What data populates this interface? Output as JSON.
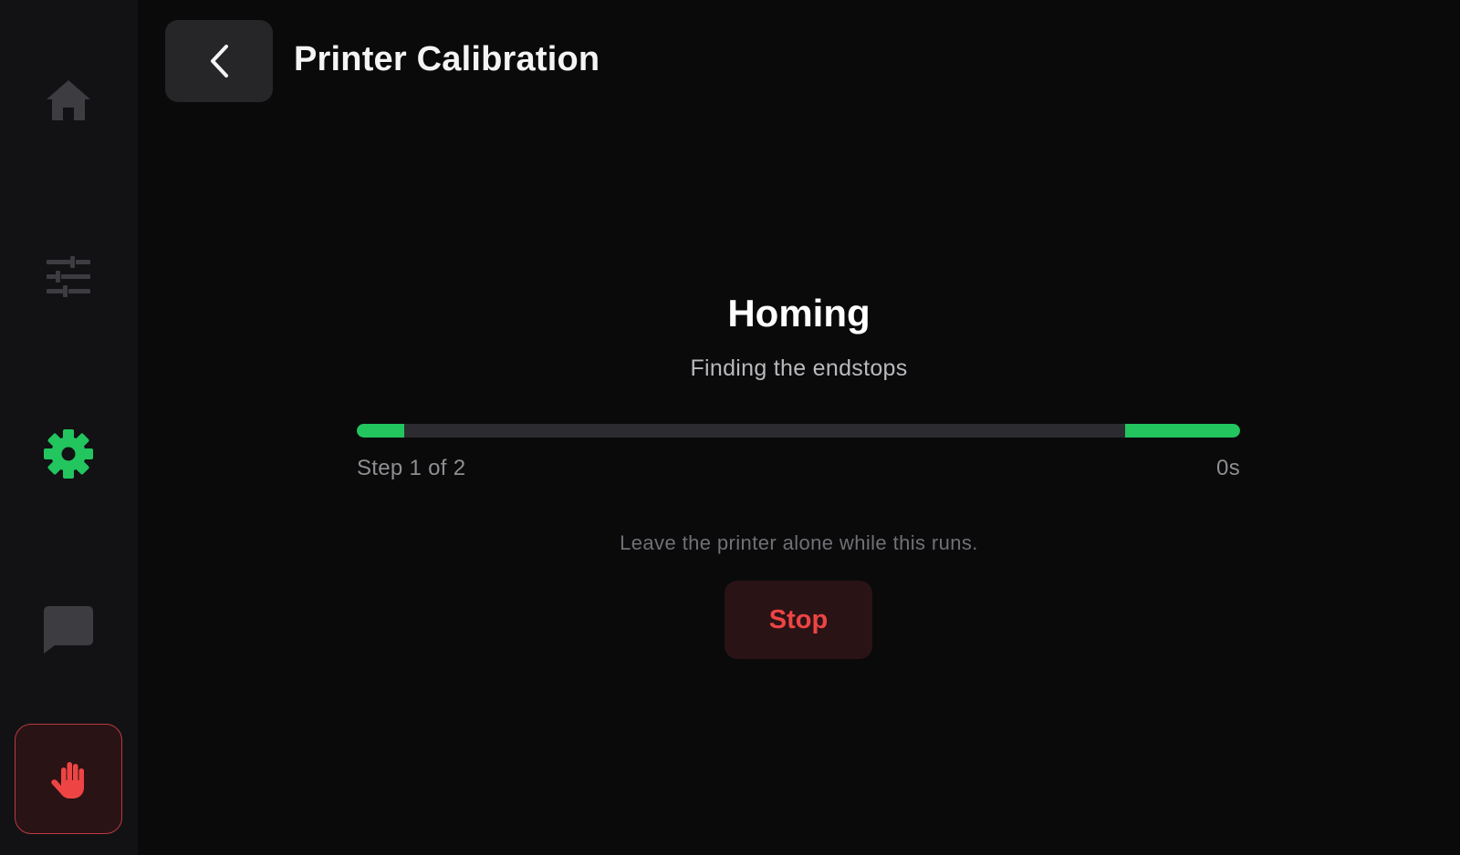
{
  "header": {
    "title": "Printer Calibration",
    "back_icon": "chevron-left-icon"
  },
  "sidebar": {
    "items": [
      {
        "id": "home",
        "icon": "home-icon",
        "active": false,
        "color": "#3c3c41"
      },
      {
        "id": "controls",
        "icon": "sliders-icon",
        "active": false,
        "color": "#3c3c41"
      },
      {
        "id": "settings",
        "icon": "gear-icon",
        "active": true,
        "color": "#22c55e"
      },
      {
        "id": "messages",
        "icon": "chat-bubble-icon",
        "active": false,
        "color": "#3c3c41"
      },
      {
        "id": "emergency-stop",
        "icon": "hand-stop-icon",
        "active": false,
        "color": "#ef4444"
      }
    ]
  },
  "status": {
    "title": "Homing",
    "subtitle": "Finding the endstops",
    "step_label": "Step 1 of 2",
    "elapsed": "0s",
    "hint": "Leave the printer alone while this runs.",
    "progress_state": "indeterminate"
  },
  "actions": {
    "stop_label": "Stop"
  },
  "colors": {
    "accent": "#22c55e",
    "danger": "#ef4444",
    "background": "#0a0a0b",
    "sidebar": "#121214"
  }
}
